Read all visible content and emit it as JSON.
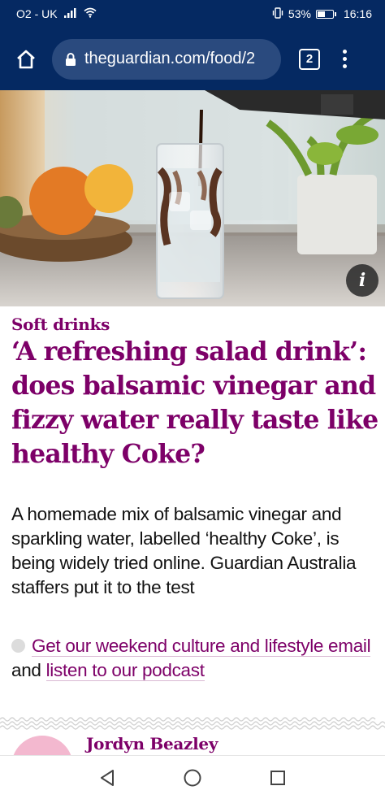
{
  "status_bar": {
    "carrier": "O2 - UK",
    "battery_percent": "53%",
    "battery_level": 0.53,
    "time": "16:16"
  },
  "browser": {
    "url": "theguardian.com/food/2",
    "tab_count": "2"
  },
  "article": {
    "kicker": "Soft drinks",
    "headline": "‘A refreshing salad drink’: does balsamic vinegar and fizzy water really taste like healthy Coke?",
    "standfirst": "A homemade mix of balsamic vinegar and sparkling water, labelled ‘healthy Coke’, is being widely tried online. Guardian Australia staffers put it to the test",
    "promo": {
      "link1": "Get our weekend culture and lifestyle email",
      "connector": " and ",
      "link2": "listen to our podcast"
    },
    "byline": "Jordyn Beazley",
    "image_info_label": "i"
  },
  "icons": {
    "home": "home-icon",
    "lock": "lock-icon",
    "menu": "more-vert-icon",
    "back": "back-triangle-icon",
    "home_nav": "circle-home-icon",
    "recents": "square-recents-icon"
  },
  "colors": {
    "guardian_blue": "#052962",
    "lifestyle_purple": "#7d0068",
    "text": "#121212"
  }
}
